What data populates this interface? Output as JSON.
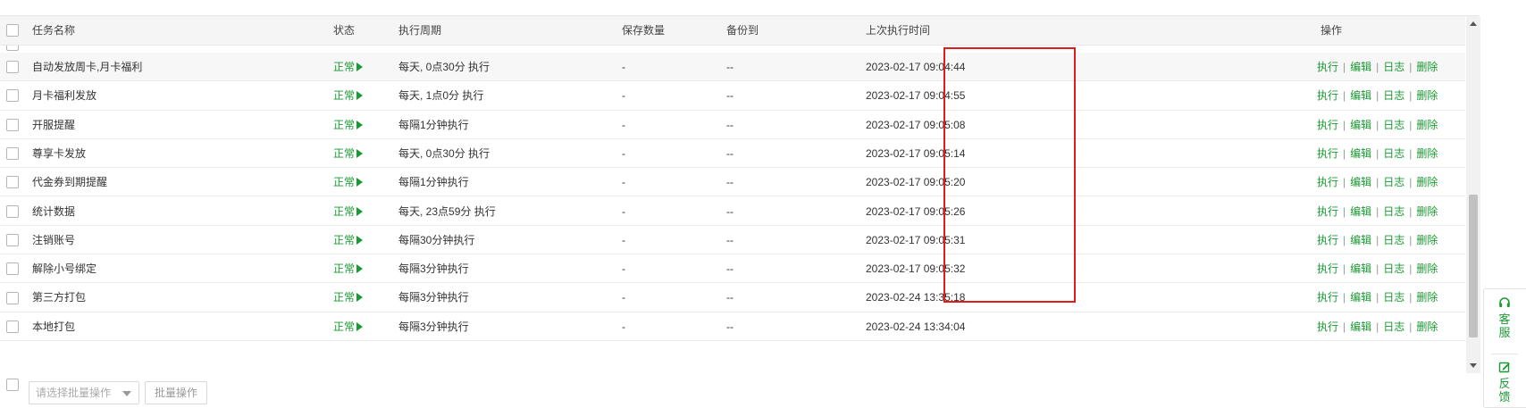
{
  "table": {
    "columns": {
      "task_name": "任务名称",
      "status": "状态",
      "cycle": "执行周期",
      "save_count": "保存数量",
      "backup_to": "备份到",
      "last_exec": "上次执行时间",
      "actions": "操作"
    },
    "rows": [
      {
        "name": "自动发放周卡,月卡福利",
        "status": "正常",
        "cycle": "每天, 0点30分 执行",
        "save_count": "-",
        "backup_to": "--",
        "last_exec": "2023-02-17 09:04:44"
      },
      {
        "name": "月卡福利发放",
        "status": "正常",
        "cycle": "每天, 1点0分 执行",
        "save_count": "-",
        "backup_to": "--",
        "last_exec": "2023-02-17 09:04:55"
      },
      {
        "name": "开服提醒",
        "status": "正常",
        "cycle": "每隔1分钟执行",
        "save_count": "-",
        "backup_to": "--",
        "last_exec": "2023-02-17 09:05:08"
      },
      {
        "name": "尊享卡发放",
        "status": "正常",
        "cycle": "每天, 0点30分 执行",
        "save_count": "-",
        "backup_to": "--",
        "last_exec": "2023-02-17 09:05:14"
      },
      {
        "name": "代金券到期提醒",
        "status": "正常",
        "cycle": "每隔1分钟执行",
        "save_count": "-",
        "backup_to": "--",
        "last_exec": "2023-02-17 09:05:20"
      },
      {
        "name": "统计数据",
        "status": "正常",
        "cycle": "每天, 23点59分 执行",
        "save_count": "-",
        "backup_to": "--",
        "last_exec": "2023-02-17 09:05:26"
      },
      {
        "name": "注销账号",
        "status": "正常",
        "cycle": "每隔30分钟执行",
        "save_count": "-",
        "backup_to": "--",
        "last_exec": "2023-02-17 09:05:31"
      },
      {
        "name": "解除小号绑定",
        "status": "正常",
        "cycle": "每隔3分钟执行",
        "save_count": "-",
        "backup_to": "--",
        "last_exec": "2023-02-17 09:05:32"
      },
      {
        "name": "第三方打包",
        "status": "正常",
        "cycle": "每隔3分钟执行",
        "save_count": "-",
        "backup_to": "--",
        "last_exec": "2023-02-24 13:35:18"
      },
      {
        "name": "本地打包",
        "status": "正常",
        "cycle": "每隔3分钟执行",
        "save_count": "-",
        "backup_to": "--",
        "last_exec": "2023-02-24 13:34:04"
      }
    ],
    "actions": {
      "execute": "执行",
      "edit": "编辑",
      "log": "日志",
      "delete": "删除",
      "separator": "|"
    }
  },
  "footer": {
    "batch_select_placeholder": "请选择批量操作",
    "batch_button": "批量操作"
  },
  "side_panel": {
    "service": "客服",
    "feedback": "反馈"
  },
  "colors": {
    "accent_green": "#1a9a33",
    "highlight_red": "#e21b1b"
  }
}
